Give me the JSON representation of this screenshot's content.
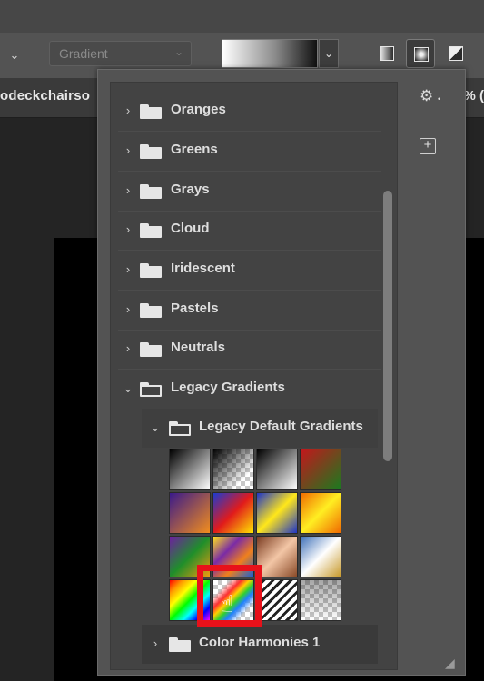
{
  "options_bar": {
    "mode_label": "Gradient",
    "collapse_chevron": "chevron-down-icon",
    "dropdown_chevron": "chevron-down-icon",
    "gradient_types": [
      "linear-gradient-icon",
      "radial-gradient-icon",
      "angle-gradient-icon"
    ],
    "selected_type": "radial-gradient-icon"
  },
  "document": {
    "title": "odeckchairso",
    "zoom": "% ("
  },
  "panel": {
    "settings_icon": "gear-icon",
    "settings_dot": "•",
    "new_preset_icon": "plus-square-icon",
    "new_preset_glyph": "+",
    "groups": [
      {
        "label": "Oranges",
        "expanded": false
      },
      {
        "label": "Greens",
        "expanded": false
      },
      {
        "label": "Grays",
        "expanded": false
      },
      {
        "label": "Cloud",
        "expanded": false
      },
      {
        "label": "Iridescent",
        "expanded": false
      },
      {
        "label": "Pastels",
        "expanded": false
      },
      {
        "label": "Neutrals",
        "expanded": false
      },
      {
        "label": "Legacy Gradients",
        "expanded": true
      }
    ],
    "subgroup": {
      "label": "Legacy Default Gradients",
      "expanded": true
    },
    "swatches": [
      {
        "row": 0,
        "col": 0,
        "style": "foreground-to-background"
      },
      {
        "row": 0,
        "col": 1,
        "style": "foreground-to-transparent"
      },
      {
        "row": 0,
        "col": 2,
        "style": "black-white"
      },
      {
        "row": 0,
        "col": 3,
        "style": "red-green"
      },
      {
        "row": 1,
        "col": 0,
        "style": "violet-orange"
      },
      {
        "row": 1,
        "col": 1,
        "style": "blue-red-yellow"
      },
      {
        "row": 1,
        "col": 2,
        "style": "blue-yellow-blue"
      },
      {
        "row": 1,
        "col": 3,
        "style": "orange-yellow-orange"
      },
      {
        "row": 2,
        "col": 0,
        "style": "violet-green-orange"
      },
      {
        "row": 2,
        "col": 1,
        "style": "yellow-violet-orange-blue"
      },
      {
        "row": 2,
        "col": 2,
        "style": "copper"
      },
      {
        "row": 2,
        "col": 3,
        "style": "chrome"
      },
      {
        "row": 3,
        "col": 0,
        "style": "spectrum"
      },
      {
        "row": 3,
        "col": 1,
        "style": "transparent-rainbow",
        "selected": true
      },
      {
        "row": 3,
        "col": 2,
        "style": "transparent-stripes"
      },
      {
        "row": 3,
        "col": 3,
        "style": "neutral-density"
      }
    ],
    "next_group": {
      "label": "Color Harmonies 1",
      "expanded": false
    }
  },
  "colors": {
    "highlight": "#e8111a",
    "panel_bg": "#535353",
    "list_bg": "#434343"
  }
}
